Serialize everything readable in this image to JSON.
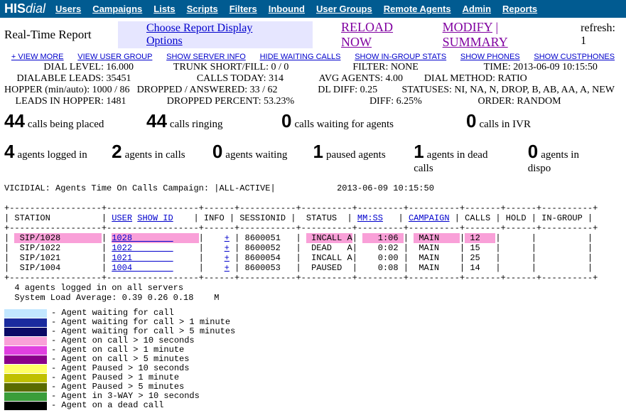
{
  "logo": {
    "pre": "HIS",
    "post": "dial"
  },
  "nav": [
    "Users",
    "Campaigns",
    "Lists",
    "Scripts",
    "Filters",
    "Inbound",
    "User Groups",
    "Remote Agents",
    "Admin",
    "Reports"
  ],
  "row2": {
    "title": "Real-Time Report",
    "choose": "Choose Report Display Options",
    "reload": "RELOAD NOW",
    "modify": "MODIFY",
    "summary": "SUMMARY",
    "refresh": "refresh: 1"
  },
  "linkbar": [
    "+ VIEW MORE",
    "VIEW USER GROUP",
    "SHOW SERVER INFO",
    "HIDE WAITING CALLS",
    "SHOW IN-GROUP STATS",
    "SHOW PHONES",
    "SHOW CUSTPHONES"
  ],
  "stats": [
    [
      {
        "l": "DIAL LEVEL:",
        "v": " 16.000",
        "lw": 140
      },
      {
        "l": "TRUNK SHORT/FILL:",
        "v": " 0 / 0",
        "lw": 180
      },
      {
        "l": "FILTER:",
        "v": " NONE",
        "lw": 130
      },
      {
        "l": "TIME:",
        "v": " 2013-06-09 10:15:50",
        "lw": 120
      }
    ],
    [
      {
        "l": "DIALABLE LEADS:",
        "v": " 35451",
        "lw": 140
      },
      {
        "l": "CALLS TODAY:",
        "v": " 314",
        "lw": 180
      },
      {
        "l": "AVG AGENTS:",
        "v": " 4.00",
        "lw": 130
      },
      {
        "l": "DIAL METHOD:",
        "v": " RATIO",
        "lw": 120
      }
    ],
    [
      {
        "l": "HOPPER (min/auto):",
        "v": " 1000 / 86",
        "lw": 140
      },
      {
        "l": "DROPPED / ANSWERED:",
        "v": " 33 / 62",
        "lw": 180
      },
      {
        "l": "DL DIFF:",
        "v": " 0.25",
        "lw": 130
      },
      {
        "l": "STATUSES:",
        "v": " NI, NA, N, DROP, B, AB, AA, A, NEW",
        "lw": 120
      }
    ],
    [
      {
        "l": "LEADS IN HOPPER:",
        "v": " 1481",
        "lw": 140
      },
      {
        "l": "DROPPED PERCENT:",
        "v": " 53.23%",
        "lw": 180
      },
      {
        "l": "DIFF:",
        "v": " 6.25%",
        "lw": 130
      },
      {
        "l": "ORDER:",
        "v": " RANDOM",
        "lw": 120
      }
    ]
  ],
  "bigrow1": [
    {
      "n": "44",
      "t": "calls being placed"
    },
    {
      "n": "44",
      "t": "calls ringing"
    },
    {
      "n": "0",
      "t": "calls waiting for agents"
    },
    {
      "n": "0",
      "t": "calls in IVR"
    }
  ],
  "bigrow2": [
    {
      "n": "4",
      "t": "agents logged in"
    },
    {
      "n": "2",
      "t": "agents in calls"
    },
    {
      "n": "0",
      "t": "agents waiting"
    },
    {
      "n": "1",
      "t": "paused agents"
    },
    {
      "n": "1",
      "t": "agents in dead calls"
    },
    {
      "n": "0",
      "t": "agents in dispo"
    }
  ],
  "mono": {
    "header1": "VICIDIAL: Agents Time On Calls Campaign: |ALL-ACTIVE|            2013-06-09 10:15:50",
    "sep": "+------------------+------------------+------+-----------+----------+---------+----------+-------+------+----------+",
    "cols": {
      "c1": "| STATION          | ",
      "user": "USER",
      "c2": " ",
      "show": "SHOW ID",
      "c3": "    | INFO | SESSIONID |  STATUS  | ",
      "mmss": "MM:SS",
      "c4": "   | ",
      "camp": "CAMPAIGN",
      "c5": " | CALLS | HOLD | IN-GROUP |"
    },
    "rows": [
      {
        "hl": true,
        "station": "SIP/1028",
        "user": "1028",
        "info": "+",
        "sess": "8600051",
        "status": "INCALL",
        "sub": "A",
        "mmss": "1:06",
        "camp": "MAIN",
        "calls": "12"
      },
      {
        "hl": false,
        "station": "SIP/1022",
        "user": "1022",
        "info": "+",
        "sess": "8600052",
        "status": "DEAD",
        "sub": "A",
        "mmss": "0:02",
        "camp": "MAIN",
        "calls": "15"
      },
      {
        "hl": false,
        "station": "SIP/1021",
        "user": "1021",
        "info": "+",
        "sess": "8600054",
        "status": "INCALL",
        "sub": "A",
        "mmss": "0:00",
        "camp": "MAIN",
        "calls": "25"
      },
      {
        "hl": false,
        "station": "SIP/1004",
        "user": "1004",
        "info": "+",
        "sess": "8600053",
        "status": "PAUSED",
        "sub": " ",
        "mmss": "0:08",
        "camp": "MAIN",
        "calls": "14"
      }
    ],
    "footer1": "  4 agents logged in on all servers",
    "footer2": "  System Load Average: 0.39 0.26 0.18    M"
  },
  "legend": [
    {
      "c": "#c2e7ff",
      "t": "- Agent waiting for call"
    },
    {
      "c": "#1a2b9e",
      "t": "- Agent waiting for call > 1 minute"
    },
    {
      "c": "#0a0a66",
      "t": "- Agent waiting for call > 5 minutes"
    },
    {
      "c": "#f9a0d8",
      "t": "- Agent on call > 10 seconds"
    },
    {
      "c": "#e040e0",
      "t": "- Agent on call > 1 minute"
    },
    {
      "c": "#8a008a",
      "t": "- Agent on call > 5 minutes"
    },
    {
      "c": "#ffff66",
      "t": "- Agent Paused > 10 seconds"
    },
    {
      "c": "#c0c000",
      "t": "- Agent Paused > 1 minute"
    },
    {
      "c": "#5a6b00",
      "t": "- Agent Paused > 5 minutes"
    },
    {
      "c": "#3a9d3a",
      "t": "- Agent in 3-WAY > 10 seconds"
    },
    {
      "c": "#000000",
      "t": "- Agent on a dead call"
    }
  ]
}
